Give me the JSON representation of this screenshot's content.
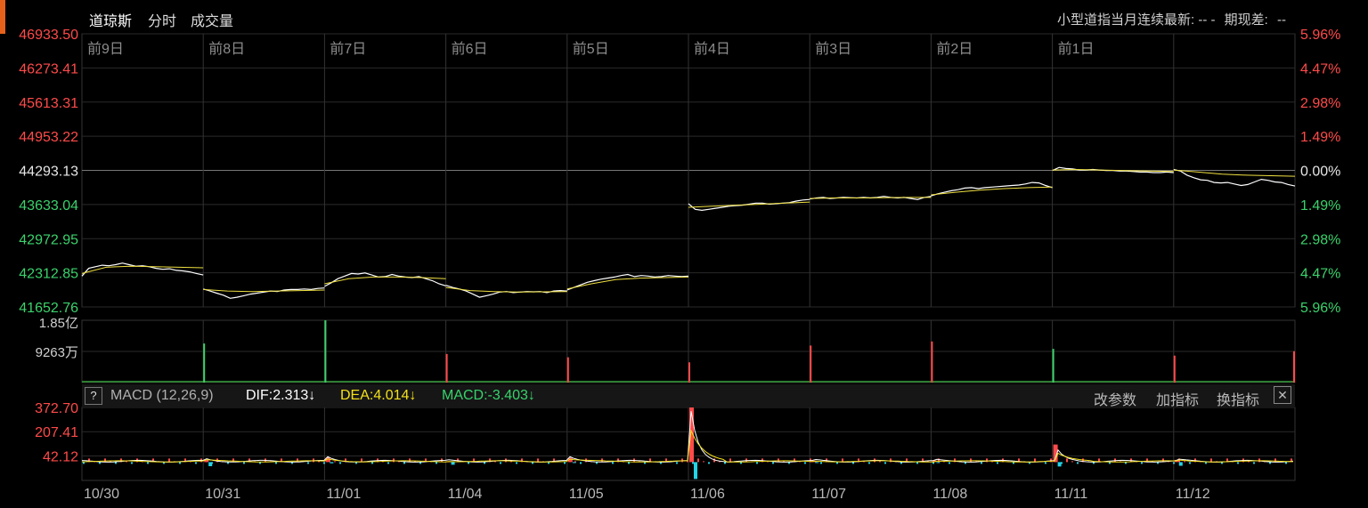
{
  "header": {
    "tabs": [
      {
        "label": "道琼斯"
      },
      {
        "label": "分时"
      },
      {
        "label": "成交量"
      }
    ],
    "contract_text": "小型道指当月连续最新: --  -",
    "spread_label": "期现差:",
    "spread_value": "--"
  },
  "colors": {
    "up": "#ff4a4a",
    "down": "#3bd26c",
    "price_line": "#ffffff",
    "avg_line": "#f0e040",
    "dea_line": "#f4e01a",
    "macd_neg": "#22d4e6",
    "grid": "#2a2a2a",
    "background": "#000000"
  },
  "macd_bar": {
    "help": "?",
    "name": "MACD (12,26,9)",
    "dif": "DIF:2.313↓",
    "dea": "DEA:4.014↓",
    "macd": "MACD:-3.403↓",
    "buttons": [
      "改参数",
      "加指标",
      "换指标"
    ],
    "close": "✕"
  },
  "chart_data": {
    "type": "line",
    "day_labels": [
      "前9日",
      "前8日",
      "前7日",
      "前6日",
      "前5日",
      "前4日",
      "前3日",
      "前2日",
      "前1日",
      ""
    ],
    "dates": [
      "10/30",
      "10/31",
      "11/01",
      "11/04",
      "11/05",
      "11/06",
      "11/07",
      "11/08",
      "11/11",
      "11/12"
    ],
    "price_axis": {
      "ticks": [
        "46933.50",
        "46273.41",
        "45613.31",
        "44953.22",
        "44293.13",
        "43633.04",
        "42972.95",
        "42312.85",
        "41652.76"
      ],
      "pct": [
        "5.96%",
        "4.47%",
        "2.98%",
        "1.49%",
        "0.00%",
        "1.49%",
        "2.98%",
        "4.47%",
        "5.96%"
      ],
      "ylim": [
        41652.76,
        46933.5
      ],
      "reference": 44293.13
    },
    "volume_axis": {
      "ticks": [
        "1.85亿",
        "9263万"
      ],
      "ylim": [
        0,
        185000000
      ]
    },
    "macd_axis": {
      "ticks": [
        "372.70",
        "207.41",
        "42.12"
      ],
      "ylim": [
        -125,
        372.7
      ]
    },
    "price_series": [
      {
        "day": 0,
        "values": [
          42250,
          42400,
          42430,
          42460,
          42450,
          42470,
          42500,
          42470,
          42440,
          42450,
          42430,
          42400,
          42380,
          42390,
          42360,
          42350,
          42330,
          42300,
          42270
        ]
      },
      {
        "day": 1,
        "values": [
          42000,
          41960,
          41920,
          41880,
          41820,
          41840,
          41870,
          41900,
          41920,
          41940,
          41960,
          41950,
          41980,
          41990,
          41990,
          42000,
          41990,
          42010,
          42020
        ]
      },
      {
        "day": 2,
        "values": [
          42050,
          42120,
          42200,
          42250,
          42300,
          42290,
          42310,
          42270,
          42230,
          42240,
          42280,
          42250,
          42230,
          42220,
          42240,
          42200,
          42160,
          42100,
          42060
        ]
      },
      {
        "day": 3,
        "values": [
          42070,
          42030,
          42000,
          41960,
          41900,
          41840,
          41870,
          41900,
          41940,
          41950,
          41930,
          41940,
          41950,
          41945,
          41950,
          41930,
          41960,
          41970,
          41960
        ]
      },
      {
        "day": 4,
        "values": [
          41980,
          42030,
          42080,
          42130,
          42160,
          42190,
          42210,
          42230,
          42260,
          42280,
          42240,
          42260,
          42250,
          42230,
          42240,
          42260,
          42250,
          42240,
          42250
        ]
      },
      {
        "day": 5,
        "values": [
          43650,
          43540,
          43520,
          43540,
          43560,
          43580,
          43600,
          43610,
          43620,
          43640,
          43660,
          43660,
          43640,
          43650,
          43660,
          43670,
          43700,
          43720,
          43730
        ]
      },
      {
        "day": 6,
        "values": [
          43740,
          43760,
          43770,
          43750,
          43760,
          43770,
          43765,
          43760,
          43770,
          43760,
          43770,
          43790,
          43770,
          43760,
          43770,
          43750,
          43730,
          43770,
          43790
        ]
      },
      {
        "day": 7,
        "values": [
          43800,
          43840,
          43870,
          43900,
          43920,
          43950,
          43960,
          43940,
          43960,
          43970,
          43980,
          43990,
          44000,
          44010,
          44030,
          44060,
          44050,
          44000,
          43960
        ]
      },
      {
        "day": 8,
        "values": [
          44290,
          44350,
          44330,
          44320,
          44300,
          44300,
          44310,
          44300,
          44290,
          44290,
          44280,
          44280,
          44270,
          44260,
          44260,
          44250,
          44250,
          44260,
          44250
        ]
      },
      {
        "day": 9,
        "values": [
          44310,
          44280,
          44200,
          44150,
          44110,
          44100,
          44060,
          44050,
          44060,
          44030,
          44000,
          44020,
          44070,
          44120,
          44100,
          44070,
          44060,
          44020,
          43990
        ]
      }
    ],
    "avg_series": [
      {
        "day": 0,
        "values": [
          42300,
          42420,
          42440,
          42430,
          42420,
          42410
        ]
      },
      {
        "day": 1,
        "values": [
          41990,
          41960,
          41950,
          41960,
          41970,
          41980
        ]
      },
      {
        "day": 2,
        "values": [
          42100,
          42200,
          42230,
          42230,
          42220,
          42200
        ]
      },
      {
        "day": 3,
        "values": [
          42030,
          41970,
          41950,
          41940,
          41945,
          41950
        ]
      },
      {
        "day": 4,
        "values": [
          42000,
          42100,
          42180,
          42210,
          42220,
          42230
        ]
      },
      {
        "day": 5,
        "values": [
          43580,
          43600,
          43620,
          43640,
          43660,
          43680
        ]
      },
      {
        "day": 6,
        "values": [
          43750,
          43760,
          43760,
          43765,
          43770,
          43770
        ]
      },
      {
        "day": 7,
        "values": [
          43820,
          43870,
          43910,
          43940,
          43960,
          43970
        ]
      },
      {
        "day": 8,
        "values": [
          44300,
          44310,
          44300,
          44290,
          44280,
          44270
        ]
      },
      {
        "day": 9,
        "values": [
          44300,
          44260,
          44220,
          44200,
          44190,
          44180
        ]
      }
    ],
    "volume_spikes": [
      {
        "day": 0,
        "value": 0
      },
      {
        "day": 1,
        "value": 116000000
      },
      {
        "day": 2,
        "value": 185000000
      },
      {
        "day": 3,
        "value": 85000000
      },
      {
        "day": 4,
        "value": 75000000
      },
      {
        "day": 5,
        "value": 60000000
      },
      {
        "day": 6,
        "value": 110000000
      },
      {
        "day": 7,
        "value": 122000000
      },
      {
        "day": 8,
        "value": 100000000
      },
      {
        "day": 9,
        "value": 80000000
      },
      {
        "day": 10,
        "value": 93000000
      }
    ],
    "macd_events": [
      {
        "day": 1,
        "peak": 15,
        "neg": -28
      },
      {
        "day": 2,
        "peak": 30,
        "neg": -8
      },
      {
        "day": 3,
        "peak": 5,
        "neg": -18
      },
      {
        "day": 4,
        "peak": 28,
        "neg": -4
      },
      {
        "day": 5,
        "peak": 372.7,
        "neg": -115
      },
      {
        "day": 6,
        "peak": 10,
        "neg": -5
      },
      {
        "day": 7,
        "peak": 12,
        "neg": -5
      },
      {
        "day": 8,
        "peak": 120,
        "neg": -30
      },
      {
        "day": 9,
        "peak": 15,
        "neg": -25
      }
    ]
  }
}
